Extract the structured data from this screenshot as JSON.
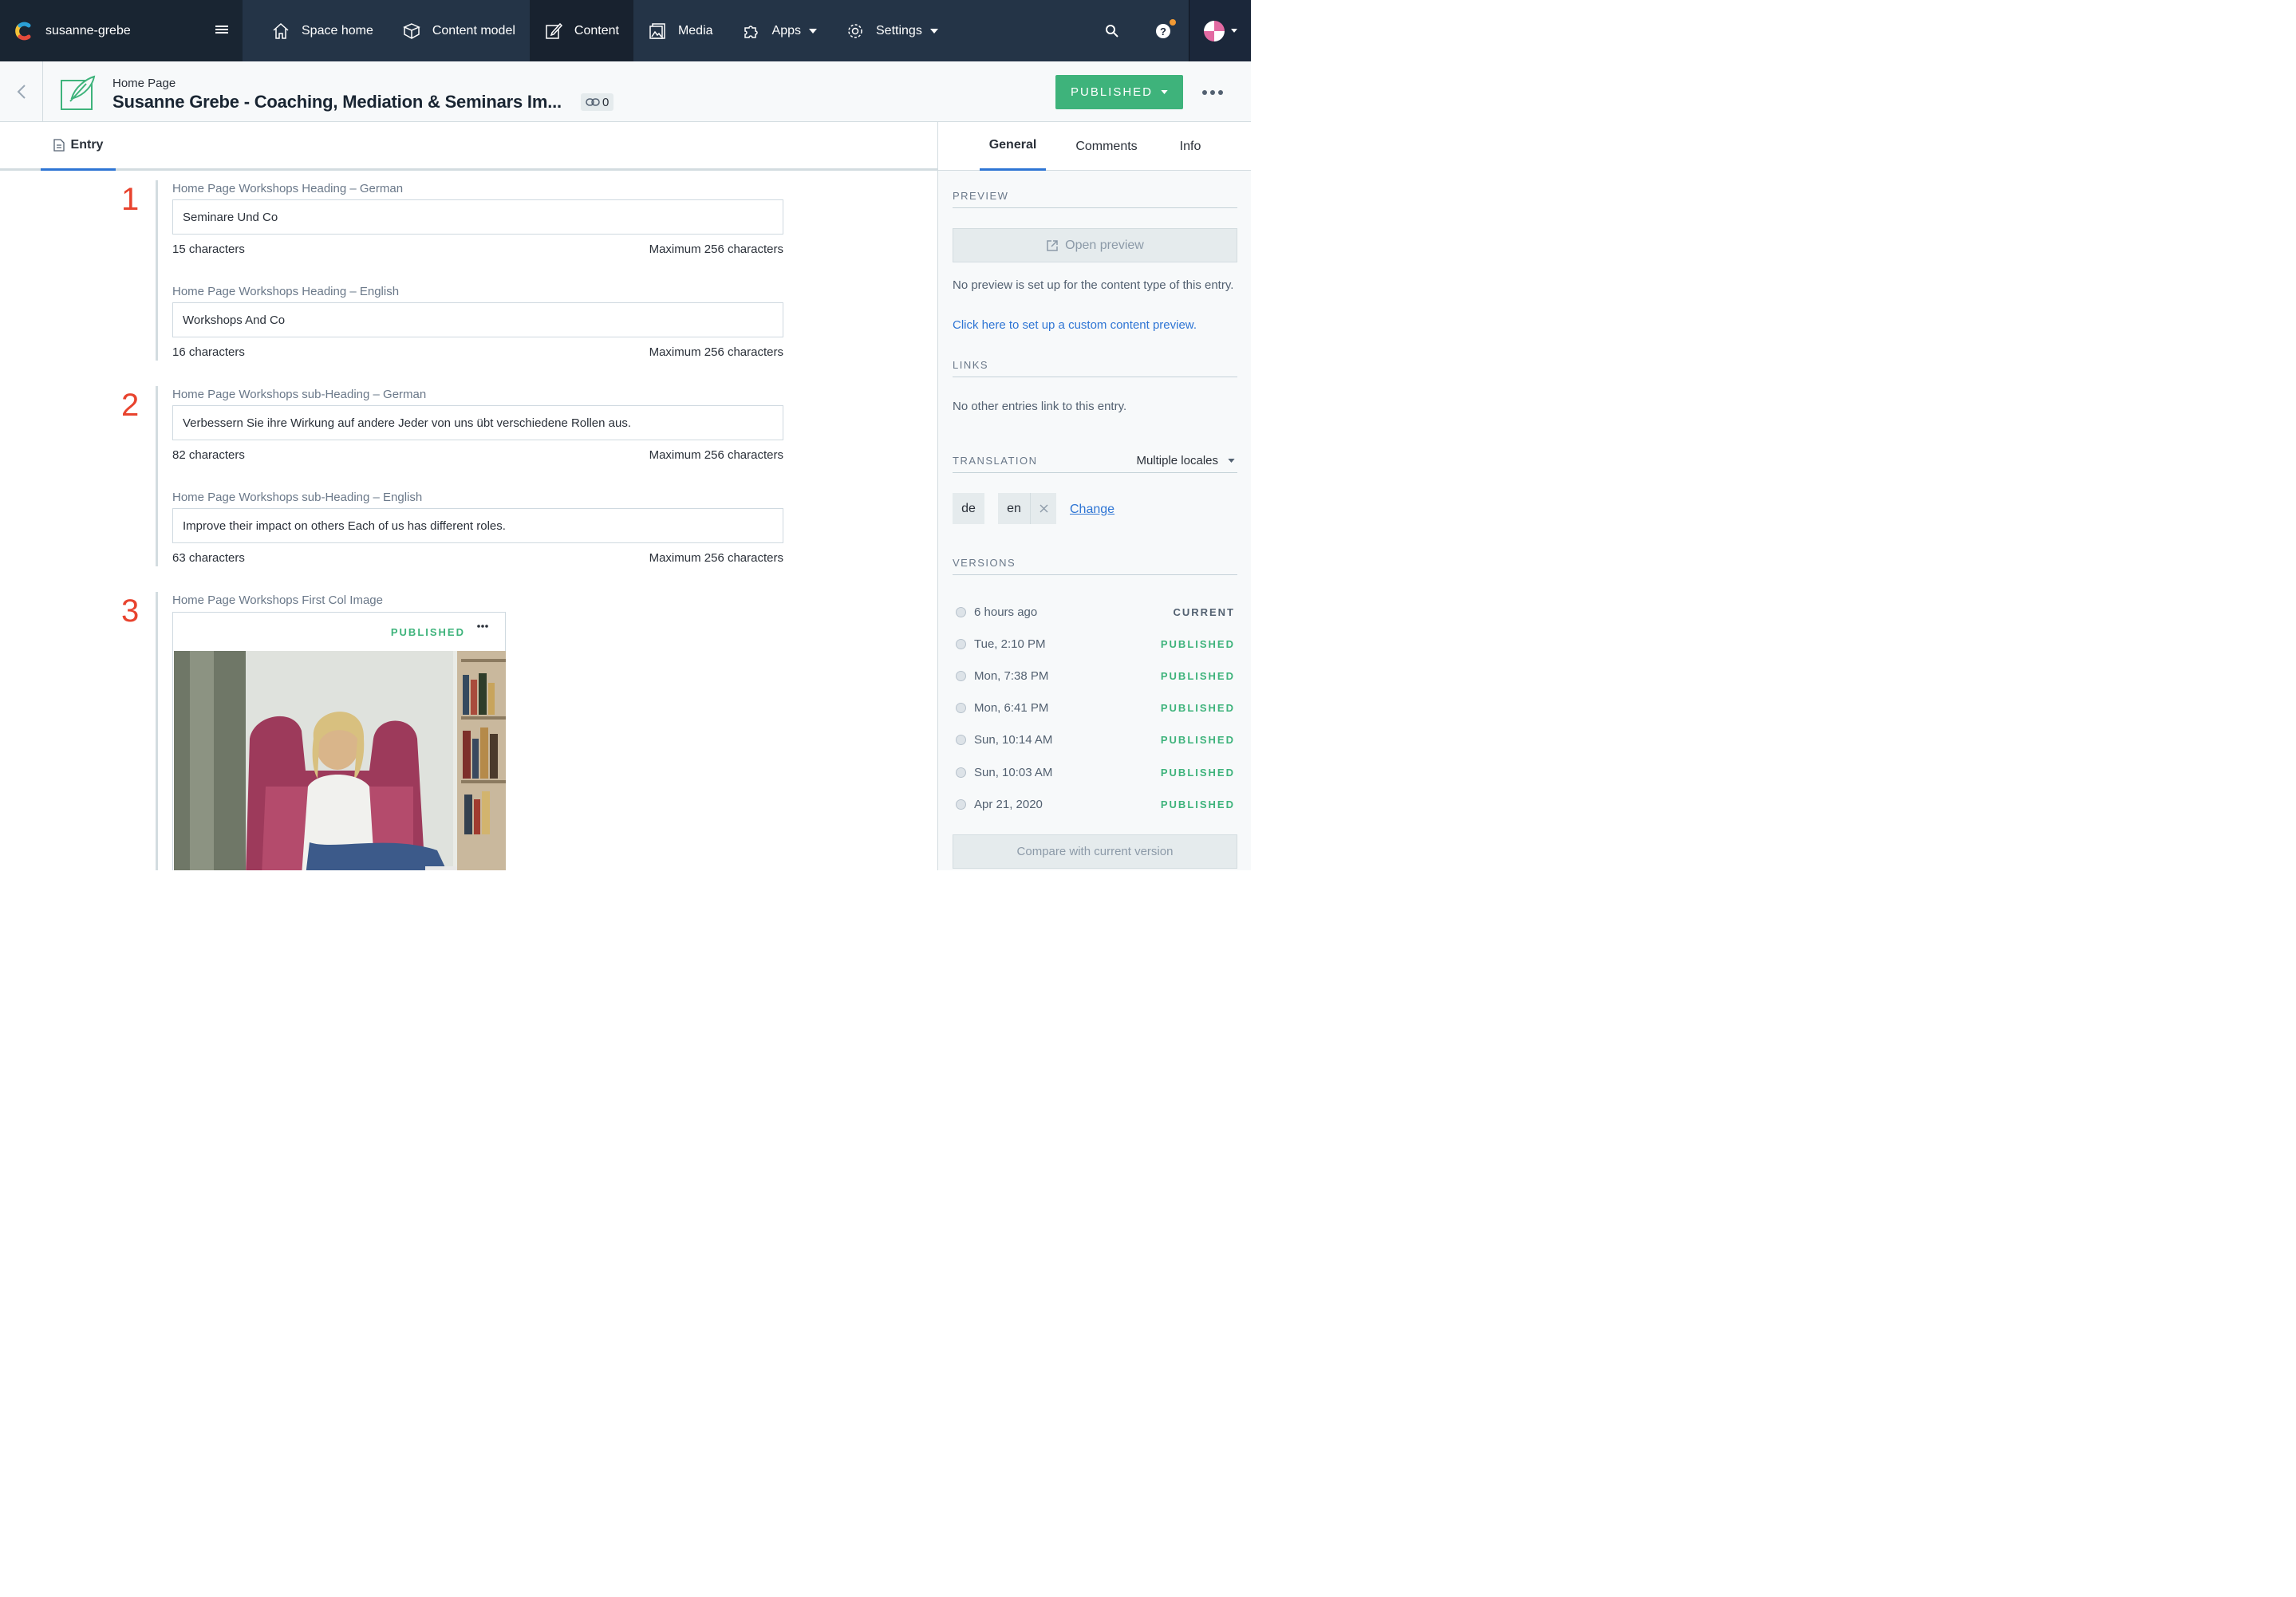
{
  "topnav": {
    "space_name": "susanne-grebe",
    "items": [
      {
        "label": "Space home",
        "icon": "home-icon"
      },
      {
        "label": "Content model",
        "icon": "content-model-icon"
      },
      {
        "label": "Content",
        "icon": "content-icon",
        "active": true
      },
      {
        "label": "Media",
        "icon": "media-icon"
      },
      {
        "label": "Apps",
        "icon": "puzzle-icon"
      },
      {
        "label": "Settings",
        "icon": "gear-icon"
      }
    ]
  },
  "header": {
    "content_type": "Home Page",
    "title": "Susanne Grebe - Coaching, Mediation & Seminars Im...",
    "link_count": "0",
    "status_button": "PUBLISHED"
  },
  "tabs": {
    "entry": "Entry",
    "side": [
      "General",
      "Comments",
      "Info"
    ]
  },
  "markers": [
    "1",
    "2",
    "3"
  ],
  "fields": [
    {
      "label": "Home Page Workshops Heading – German",
      "value": "Seminare Und Co",
      "count": "15 characters",
      "max": "Maximum 256 characters"
    },
    {
      "label": "Home Page Workshops Heading – English",
      "value": "Workshops And Co",
      "count": "16 characters",
      "max": "Maximum 256 characters"
    },
    {
      "label": "Home Page Workshops sub-Heading – German",
      "value": "Verbessern Sie ihre Wirkung auf andere Jeder von uns übt verschiedene Rollen aus.",
      "count": "82 characters",
      "max": "Maximum 256 characters"
    },
    {
      "label": "Home Page Workshops sub-Heading – English",
      "value": "Improve their impact on others Each of us has different roles.",
      "count": "63 characters",
      "max": "Maximum 256 characters"
    }
  ],
  "image_field": {
    "label": "Home Page Workshops First Col Image",
    "status": "PUBLISHED"
  },
  "sidebar": {
    "preview": {
      "heading": "PREVIEW",
      "button": "Open preview",
      "note": "No preview is set up for the content type of this entry.",
      "link": "Click here to set up a custom content preview."
    },
    "links": {
      "heading": "LINKS",
      "note": "No other entries link to this entry."
    },
    "translation": {
      "heading": "TRANSLATION",
      "dropdown": "Multiple locales",
      "locales": [
        "de",
        "en"
      ],
      "change": "Change"
    },
    "versions": {
      "heading": "VERSIONS",
      "items": [
        {
          "time": "6 hours ago",
          "status": "CURRENT"
        },
        {
          "time": "Tue, 2:10 PM",
          "status": "PUBLISHED"
        },
        {
          "time": "Mon, 7:38 PM",
          "status": "PUBLISHED"
        },
        {
          "time": "Mon, 6:41 PM",
          "status": "PUBLISHED"
        },
        {
          "time": "Sun, 10:14 AM",
          "status": "PUBLISHED"
        },
        {
          "time": "Sun, 10:03 AM",
          "status": "PUBLISHED"
        },
        {
          "time": "Apr 21, 2020",
          "status": "PUBLISHED"
        }
      ],
      "compare": "Compare with current version"
    }
  },
  "colors": {
    "nav_bg": "#1b273a",
    "accent_blue": "#2e75d4",
    "published_green": "#3eb37b",
    "marker_red": "#e8432e"
  }
}
